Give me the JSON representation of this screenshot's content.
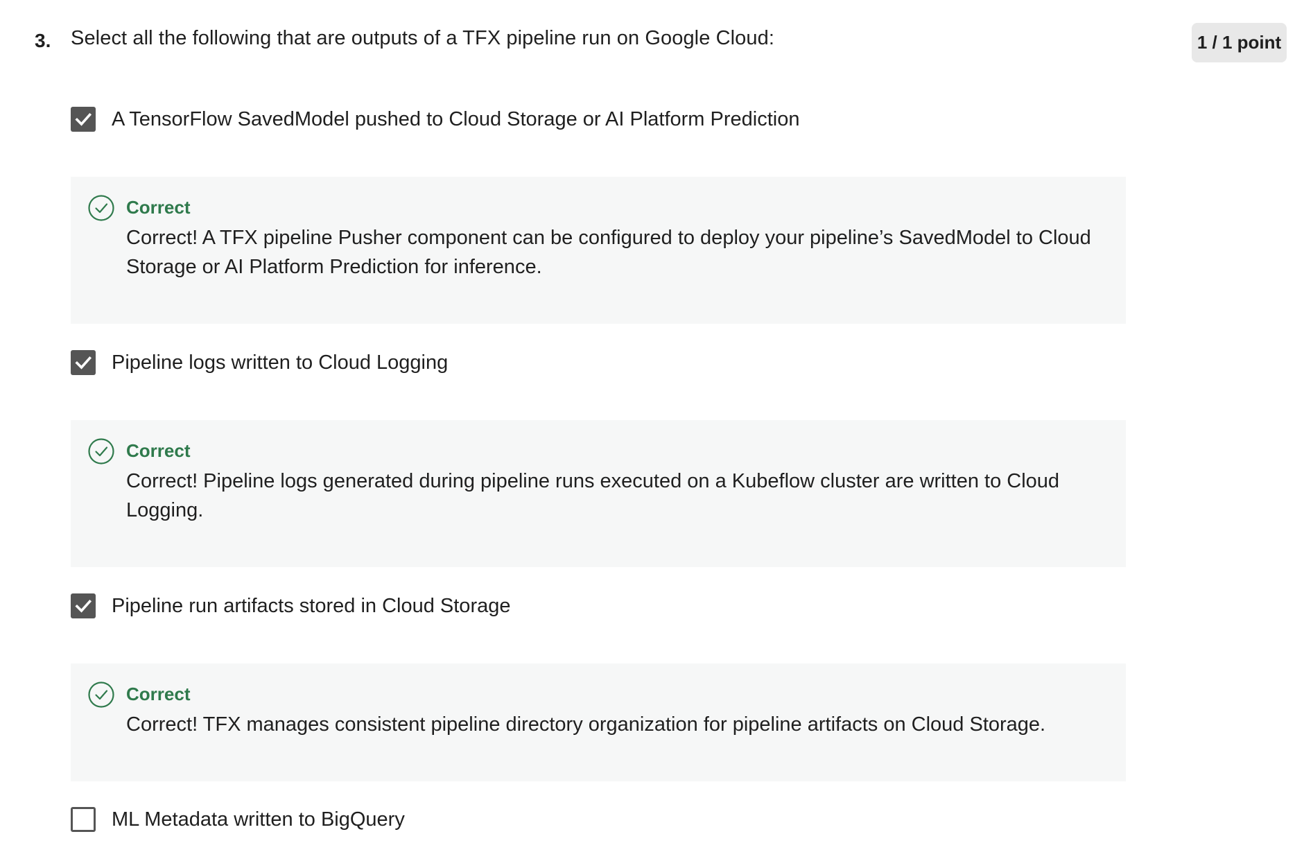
{
  "question": {
    "number": "3.",
    "text": "Select all the following that are outputs of a TFX pipeline run on Google Cloud:",
    "points": "1 / 1 point"
  },
  "colors": {
    "correct_green": "#2f7a4c",
    "checkbox_fill": "#555555",
    "feedback_bg": "#f6f7f7",
    "badge_bg": "#e8e8e8"
  },
  "options": [
    {
      "label": "A TensorFlow SavedModel pushed to Cloud Storage or AI Platform Prediction",
      "checked": true,
      "feedback": {
        "icon": "check-circle-icon",
        "title": "Correct",
        "text": "Correct! A TFX pipeline Pusher component can be configured to deploy your pipeline’s SavedModel to Cloud Storage or AI Platform Prediction for inference."
      }
    },
    {
      "label": "Pipeline logs written to Cloud Logging",
      "checked": true,
      "feedback": {
        "icon": "check-circle-icon",
        "title": "Correct",
        "text": "Correct! Pipeline logs generated during pipeline runs executed on a Kubeflow cluster are written to Cloud Logging."
      }
    },
    {
      "label": "Pipeline run artifacts stored in Cloud Storage",
      "checked": true,
      "feedback": {
        "icon": "check-circle-icon",
        "title": "Correct",
        "text": "Correct! TFX manages consistent pipeline directory organization for pipeline artifacts on Cloud Storage."
      }
    },
    {
      "label": "ML Metadata written to BigQuery",
      "checked": false
    }
  ]
}
